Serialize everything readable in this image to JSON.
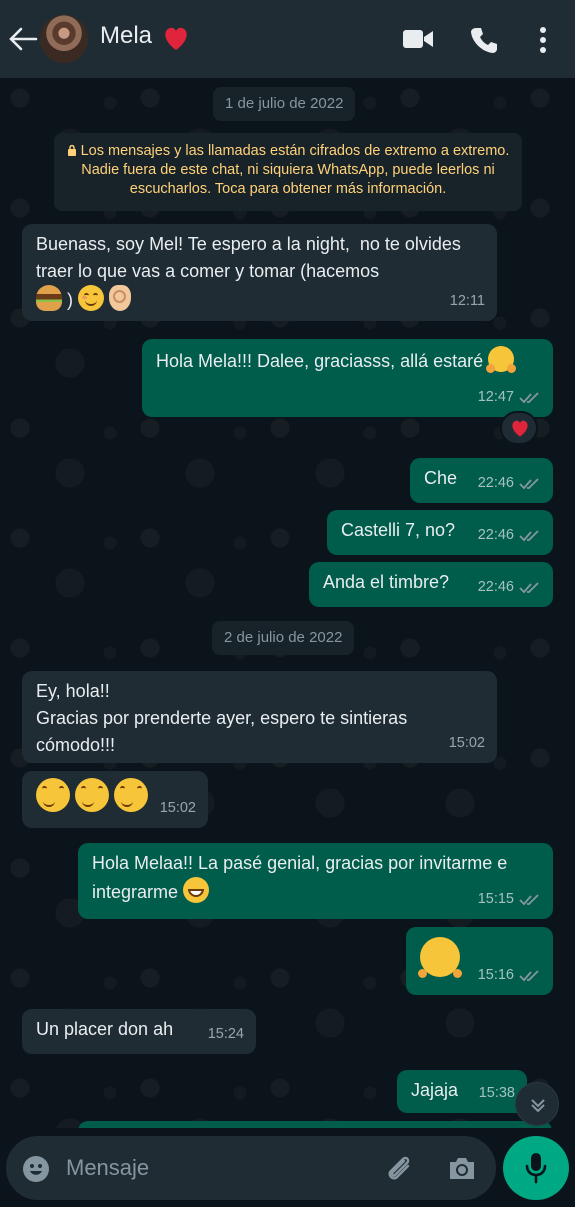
{
  "header": {
    "contact_name": "Mela",
    "icons": [
      "back-arrow-icon",
      "avatar",
      "heart-icon",
      "video-call-icon",
      "phone-icon",
      "more-options-icon"
    ]
  },
  "chat": {
    "date_1": "1 de julio de 2022",
    "encryption_notice": "Los mensajes y las llamadas están cifrados de extremo a extremo. Nadie fuera de este chat, ni siquiera WhatsApp, puede leerlos ni escucharlos. Toca para obtener más información.",
    "date_2": "2 de julio de 2022",
    "messages": [
      {
        "dir": "in",
        "text": "Buenass, soy Mel! Te espero a la night,  no te olvides traer lo que vas a comer y tomar (hacemos",
        "time": "12:11"
      },
      {
        "dir": "out",
        "text": "Hola Mela!!! Dalee, graciasss, allá estaré",
        "time": "12:47"
      },
      {
        "dir": "out",
        "text": "Che",
        "time": "22:46"
      },
      {
        "dir": "out",
        "text": "Castelli 7, no?",
        "time": "22:46"
      },
      {
        "dir": "out",
        "text": "Anda el timbre?",
        "time": "22:46"
      },
      {
        "dir": "in",
        "text": "Ey, hola!!\nGracias por prenderte ayer, espero te sintieras cómodo!!!",
        "time": "15:02"
      },
      {
        "dir": "in",
        "text": "",
        "time": "15:02"
      },
      {
        "dir": "out",
        "text": "Hola Melaa!! La pasé genial, gracias por invitarme e integrarme",
        "time": "15:15"
      },
      {
        "dir": "out",
        "text": "",
        "time": "15:16"
      },
      {
        "dir": "in",
        "text": "Un placer don ah",
        "time": "15:24"
      },
      {
        "dir": "out",
        "text": "Jajaja",
        "time": "15:38"
      }
    ]
  },
  "composer": {
    "placeholder": "Mensaje"
  },
  "colors": {
    "background": "#0b141a",
    "header": "#1f2c34",
    "incoming": "#1f2c34",
    "outgoing": "#005c4b",
    "accent": "#00a884",
    "encryption_text": "#ffd279"
  }
}
